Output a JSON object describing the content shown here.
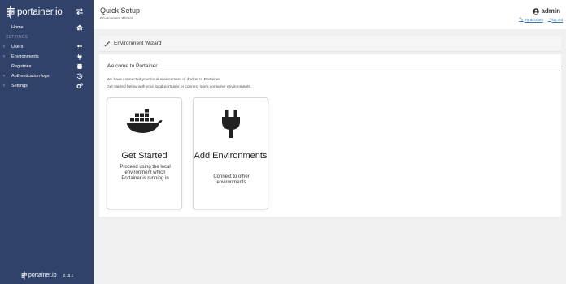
{
  "sidebar": {
    "brand": "portainer.io",
    "items": [
      {
        "label": "Home",
        "icon": "home-icon"
      },
      {
        "label": "Users",
        "icon": "users-icon"
      },
      {
        "label": "Environments",
        "icon": "plug-icon"
      },
      {
        "label": "Registries",
        "icon": "database-icon"
      },
      {
        "label": "Authentication logs",
        "icon": "history-icon"
      },
      {
        "label": "Settings",
        "icon": "cogs-icon"
      }
    ],
    "section_label": "SETTINGS",
    "footer": {
      "brand": "portainer.io",
      "version": "2.15.1"
    }
  },
  "header": {
    "title": "Quick Setup",
    "subtitle": "Environment Wizard",
    "username": "admin",
    "my_account": "my account",
    "log_out": "log out"
  },
  "widget": {
    "title": "Environment Wizard",
    "welcome": "Welcome to Portainer",
    "intro1": "We have connected your local environment of docker to Portainer.",
    "intro2": "Get started below with your local portainer or connect more container environments."
  },
  "cards": [
    {
      "title": "Get Started",
      "description": "Proceed using the local environment which Portainer is running in",
      "icon": "docker-icon"
    },
    {
      "title": "Add Environments",
      "description": "Connect to other environments",
      "icon": "plug-icon"
    }
  ],
  "colors": {
    "sidebar_bg": "#30426a",
    "link": "#337ab7",
    "page_bg": "#f0f0f0"
  }
}
